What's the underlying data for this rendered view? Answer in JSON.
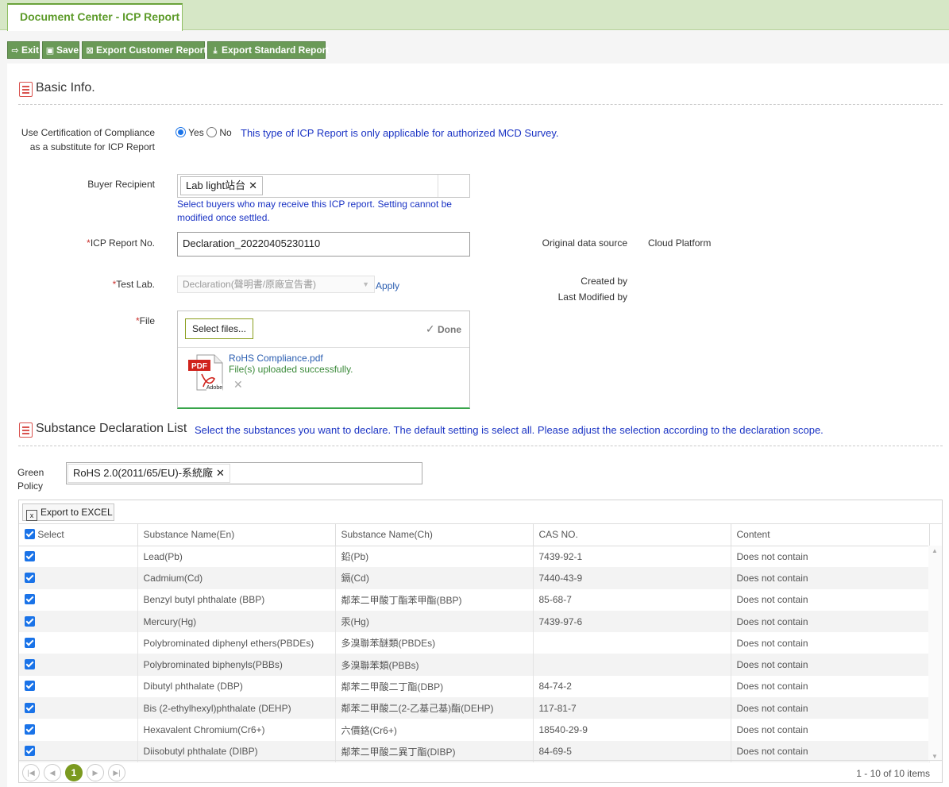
{
  "tab": {
    "label": "Document Center - ICP Report"
  },
  "toolbar": {
    "exit": "Exit",
    "save": "Save",
    "export_customer": "Export Customer Report",
    "export_standard": "Export Standard Report"
  },
  "basic": {
    "title": "Basic Info.",
    "coc_label_1": "Use Certification of Compliance",
    "coc_label_2": "as a substitute for ICP Report",
    "yes": "Yes",
    "no": "No",
    "coc_note": "This type of ICP Report is only applicable for authorized MCD Survey.",
    "buyer_label": "Buyer Recipient",
    "buyer_chip": "Lab light站台",
    "buyer_note_1": "Select buyers who may receive this ICP report. Setting cannot be",
    "buyer_note_2": "modified once settled.",
    "report_no_label": "ICP Report No.",
    "report_no_value": "Declaration_20220405230110",
    "orig_source_label": "Original data source",
    "orig_source_value": "Cloud Platform",
    "test_lab_label": "Test Lab.",
    "test_lab_value": "Declaration(聲明書/原廠宣告書)",
    "apply": "Apply",
    "created_by_label": "Created by",
    "last_modified_label": "Last Modified by",
    "file_label": "File",
    "select_files": "Select files...",
    "done": "Done",
    "file_name": "RoHS Compliance.pdf",
    "file_status": "File(s) uploaded successfully.",
    "required_mark": "*"
  },
  "substance": {
    "title": "Substance Declaration List",
    "note": "Select the substances you want to declare. The default setting is select all. Please adjust the selection according to the declaration scope.",
    "policy_label_1": "Green",
    "policy_label_2": "Policy",
    "policy_chip": "RoHS 2.0(2011/65/EU)-系統廠",
    "export_excel": "Export to EXCEL",
    "columns": [
      "Select",
      "Substance Name(En)",
      "Substance Name(Ch)",
      "CAS NO.",
      "Content"
    ],
    "rows": [
      {
        "en": "Lead(Pb)",
        "ch": "鉛(Pb)",
        "cas": "7439-92-1",
        "content": "Does not contain"
      },
      {
        "en": "Cadmium(Cd)",
        "ch": "鎘(Cd)",
        "cas": "7440-43-9",
        "content": "Does not contain"
      },
      {
        "en": "Benzyl butyl phthalate (BBP)",
        "ch": "鄰苯二甲酸丁酯苯甲酯(BBP)",
        "cas": "85-68-7",
        "content": "Does not contain"
      },
      {
        "en": "Mercury(Hg)",
        "ch": "汞(Hg)",
        "cas": "7439-97-6",
        "content": "Does not contain"
      },
      {
        "en": "Polybrominated diphenyl ethers(PBDEs)",
        "ch": "多溴聯苯醚類(PBDEs)",
        "cas": "",
        "content": "Does not contain"
      },
      {
        "en": "Polybrominated biphenyls(PBBs)",
        "ch": "多溴聯苯類(PBBs)",
        "cas": "",
        "content": "Does not contain"
      },
      {
        "en": "Dibutyl phthalate (DBP)",
        "ch": "鄰苯二甲酸二丁酯(DBP)",
        "cas": "84-74-2",
        "content": "Does not contain"
      },
      {
        "en": "Bis (2-ethylhexyl)phthalate (DEHP)",
        "ch": "鄰苯二甲酸二(2-乙基己基)酯(DEHP)",
        "cas": "117-81-7",
        "content": "Does not contain"
      },
      {
        "en": "Hexavalent Chromium(Cr6+)",
        "ch": "六價鉻(Cr6+)",
        "cas": "18540-29-9",
        "content": "Does not contain"
      },
      {
        "en": "Diisobutyl phthalate (DIBP)",
        "ch": "鄰苯二甲酸二異丁酯(DIBP)",
        "cas": "84-69-5",
        "content": "Does not contain"
      }
    ],
    "page": "1",
    "page_info": "1 - 10 of 10 items"
  }
}
